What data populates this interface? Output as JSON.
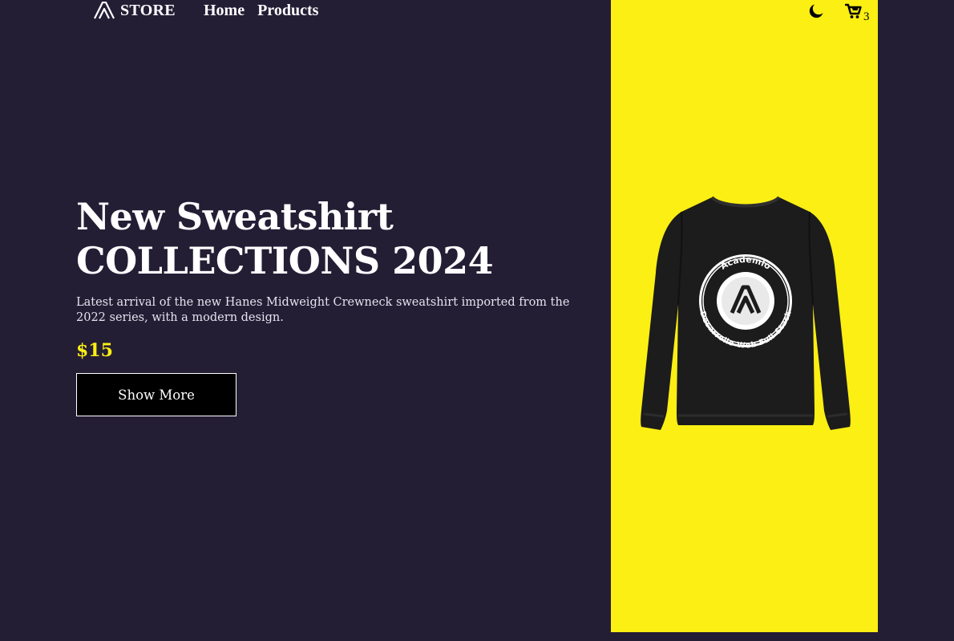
{
  "header": {
    "logo_text": "STORE",
    "nav": [
      {
        "label": "Home"
      },
      {
        "label": "Products"
      }
    ],
    "theme_icon": "moon-icon",
    "cart_icon": "cart-icon",
    "cart_count": "3"
  },
  "hero": {
    "title_line1": "New Sweatshirt",
    "title_line2": "COLLECTIONS 2024",
    "description": "Latest arrival of the new Hanes Midweight Crewneck sweatshirt imported from the 2022 series, with a modern design.",
    "price": "$15",
    "button_label": "Show More"
  },
  "product": {
    "badge_top": "Academlo",
    "badge_bottom": "Desarrollo Web Full-Stack"
  },
  "colors": {
    "background": "#241e35",
    "accent": "#fbef13",
    "button": "#000000"
  }
}
